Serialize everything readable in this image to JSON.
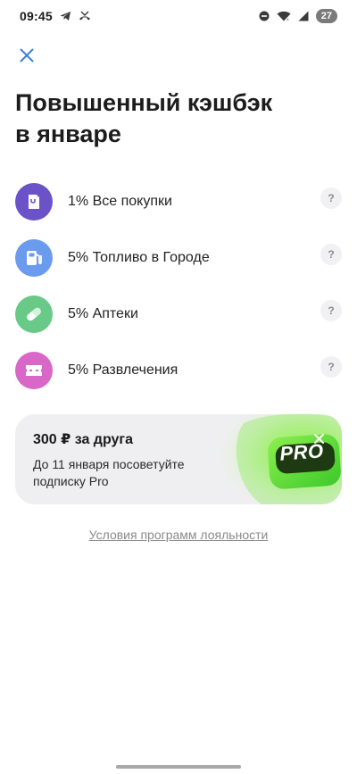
{
  "status_bar": {
    "time": "09:45",
    "battery": "27",
    "left_icons": [
      "telegram-icon",
      "missed-call-icon"
    ],
    "right_icons": [
      "dnd-icon",
      "wifi-icon",
      "signal-icon",
      "battery-icon"
    ]
  },
  "header": {
    "close_icon": "close-icon",
    "accent_color": "#3d7fd9"
  },
  "title": {
    "line1": "Повышенный кэшбэк",
    "line2": "в январе"
  },
  "cashback": {
    "items": [
      {
        "label": "1% Все покупки",
        "icon": "shopping-bag-icon",
        "color": "#6b52c8",
        "help": "?"
      },
      {
        "label": "5% Топливо в Городе",
        "icon": "fuel-pump-icon",
        "color": "#6b9bef",
        "help": "?"
      },
      {
        "label": "5% Аптеки",
        "icon": "pill-icon",
        "color": "#69c987",
        "help": "?"
      },
      {
        "label": "5% Развлечения",
        "icon": "ticket-icon",
        "color": "#d967c8",
        "help": "?"
      }
    ]
  },
  "promo": {
    "title": "300 ₽ за друга",
    "description": "До 11 января посоветуйте подписку Pro",
    "badge": "PRO",
    "badge_color": "#5fd93a"
  },
  "footer": {
    "terms_link": "Условия программ лояльности"
  }
}
